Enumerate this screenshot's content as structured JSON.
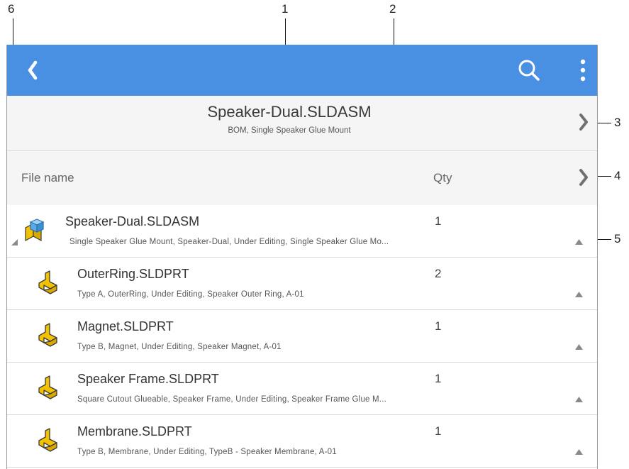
{
  "callouts": {
    "n1": "1",
    "n2": "2",
    "n3": "3",
    "n4": "4",
    "n5": "5",
    "n6": "6"
  },
  "header": {
    "title": "Speaker-Dual.SLDASM",
    "subtitle": "BOM, Single Speaker Glue Mount"
  },
  "columns": {
    "file_name": "File name",
    "qty": "Qty"
  },
  "rows": [
    {
      "title": "Speaker-Dual.SLDASM",
      "qty": "1",
      "details": "Single Speaker Glue Mount, Speaker-Dual, Under Editing, Single Speaker Glue Mo...",
      "icon": "assembly-icon"
    },
    {
      "title": "OuterRing.SLDPRT",
      "qty": "2",
      "details": "Type A, OuterRing, Under Editing, Speaker Outer Ring, A-01",
      "icon": "part-icon"
    },
    {
      "title": "Magnet.SLDPRT",
      "qty": "1",
      "details": "Type B, Magnet, Under Editing, Speaker Magnet, A-01",
      "icon": "part-icon"
    },
    {
      "title": "Speaker Frame.SLDPRT",
      "qty": "1",
      "details": "Square Cutout Glueable, Speaker Frame, Under Editing, Speaker Frame Glue M...",
      "icon": "part-icon"
    },
    {
      "title": "Membrane.SLDPRT",
      "qty": "1",
      "details": "Type B, Membrane, Under Editing, TypeB - Speaker Membrane, A-01",
      "icon": "part-icon"
    }
  ],
  "colors": {
    "appbar": "#4a90e2",
    "header_bg": "#f5f5f5",
    "part_icon": "#f2c200"
  }
}
